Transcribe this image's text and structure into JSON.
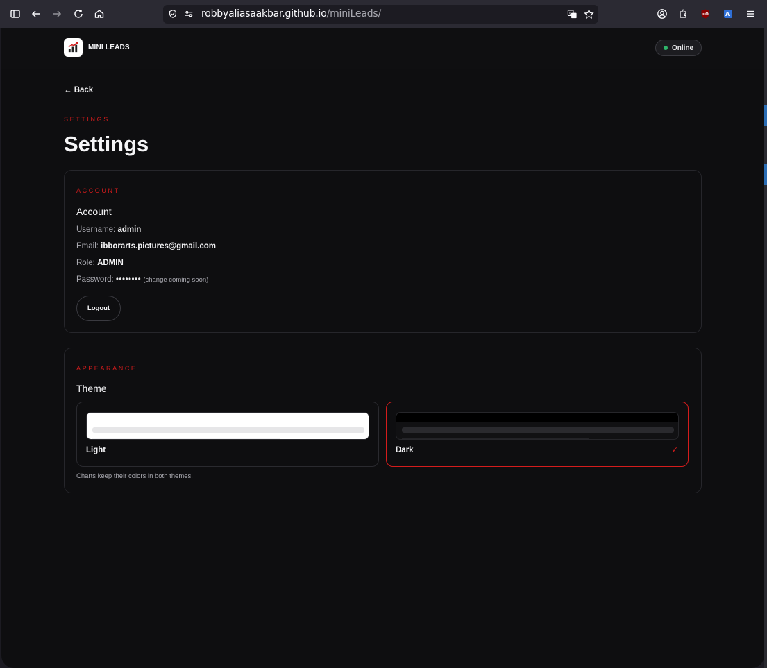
{
  "browser": {
    "url_host": "robbyaliasaakbar.github.io",
    "url_path": "/miniLeads/"
  },
  "header": {
    "brand": "MINI LEADS",
    "status": "Online"
  },
  "nav": {
    "back": "← Back"
  },
  "page": {
    "eyebrow": "SETTINGS",
    "title": "Settings"
  },
  "account": {
    "eyebrow": "ACCOUNT",
    "title": "Account",
    "username_label": "Username:",
    "username": "admin",
    "email_label": "Email:",
    "email": "ibborarts.pictures@gmail.com",
    "role_label": "Role:",
    "role": "ADMIN",
    "password_label": "Password:",
    "password": "••••••••",
    "password_hint": "(change coming soon)",
    "logout": "Logout"
  },
  "appearance": {
    "eyebrow": "APPEARANCE",
    "title": "Theme",
    "options": [
      {
        "label": "Light",
        "selected": false
      },
      {
        "label": "Dark",
        "selected": true
      }
    ],
    "check": "✓",
    "footnote": "Charts keep their colors in both themes."
  },
  "colors": {
    "accent": "#d41c1c",
    "status_online": "#2fb56a",
    "background": "#0e0e10"
  },
  "icons": [
    "sidebar-icon",
    "back-arrow-icon",
    "forward-arrow-icon",
    "reload-icon",
    "home-icon",
    "shield-icon",
    "permissions-icon",
    "translate-icon",
    "bookmark-star-icon",
    "account-icon",
    "extensions-icon",
    "ublock-icon",
    "translator-extension-icon",
    "menu-icon",
    "app-logo-icon"
  ]
}
